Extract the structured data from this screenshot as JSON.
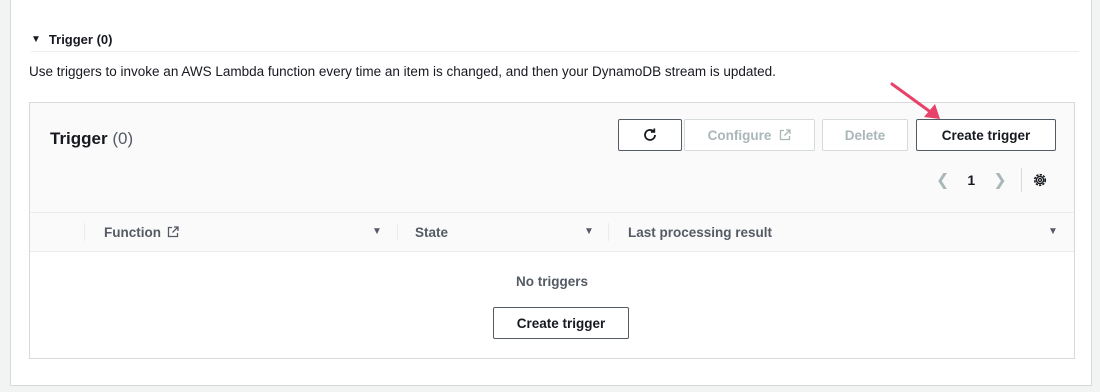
{
  "section": {
    "title": "Trigger (0)",
    "description": "Use triggers to invoke an AWS Lambda function every time an item is changed, and then your DynamoDB stream is updated."
  },
  "panel": {
    "title": "Trigger",
    "count": "(0)",
    "buttons": {
      "configure": "Configure",
      "delete": "Delete",
      "create": "Create trigger"
    },
    "pagination": {
      "page": "1"
    }
  },
  "table": {
    "columns": [
      "Function",
      "State",
      "Last processing result"
    ],
    "empty_text": "No triggers",
    "empty_button": "Create trigger"
  },
  "colors": {
    "annotation_arrow": "#e8426a",
    "text": "#16191f",
    "disabled": "#aab7b8"
  },
  "icons": [
    "caret-down-icon",
    "refresh-icon",
    "external-link-icon",
    "chevron-left-icon",
    "chevron-right-icon",
    "gear-icon",
    "sort-icon"
  ]
}
